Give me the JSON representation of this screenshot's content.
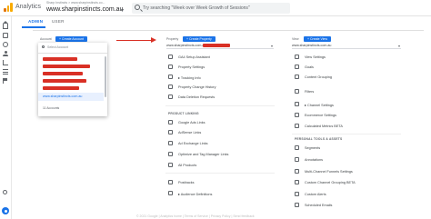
{
  "header": {
    "app_title": "Analytics",
    "account_small": "Sharp Instincts > www.sharpinstincts.co...",
    "account_name": "www.sharpinstincts.com.au",
    "search_placeholder": "Try searching \"Week over Week Growth of Sessions\""
  },
  "tabs": {
    "admin": "ADMIN",
    "user": "USER"
  },
  "account_column": {
    "label": "Account",
    "create_button": "+ Create Account",
    "dropdown": {
      "search_placeholder": "Select Account",
      "selected_item": "www.sharpinstincts.com.au",
      "footer": "11 Accounts"
    }
  },
  "property_column": {
    "label": "Property",
    "create_button": "+ Create Property",
    "selected": "www.sharpinstincts.com.au",
    "items": [
      {
        "icon": "ga4-icon",
        "label": "GA4 Setup Assistant"
      },
      {
        "icon": "settings-icon",
        "label": "Property Settings"
      },
      {
        "icon": "code-icon",
        "label": "Tracking Info",
        "expandable": true
      },
      {
        "icon": "history-icon",
        "label": "Property Change History"
      },
      {
        "icon": "dd-icon",
        "label": "Data Deletion Requests"
      }
    ],
    "section_product_links": "PRODUCT LINKING",
    "product_links": [
      {
        "icon": "ads-icon",
        "label": "Google Ads Links"
      },
      {
        "icon": "adsense-icon",
        "label": "AdSense Links"
      },
      {
        "icon": "exchange-icon",
        "label": "Ad Exchange Links"
      },
      {
        "icon": "optimize-icon",
        "label": "Optimize and Tag Manager Links"
      },
      {
        "icon": "products-icon",
        "label": "All Products"
      }
    ],
    "postbacks": "Postbacks",
    "audience": "Audience Definitions"
  },
  "view_column": {
    "label": "View",
    "create_button": "+ Create View",
    "selected": "www.sharpinstincts.com.au",
    "items": [
      {
        "icon": "view-settings-icon",
        "label": "View Settings"
      },
      {
        "icon": "goals-icon",
        "label": "Goals"
      },
      {
        "icon": "grouping-icon",
        "label": "Content Grouping"
      },
      {
        "icon": "filter-icon",
        "label": "Filters"
      },
      {
        "icon": "channel-icon",
        "label": "Channel Settings",
        "expandable": true
      },
      {
        "icon": "ecommerce-icon",
        "label": "Ecommerce Settings"
      },
      {
        "icon": "calc-icon",
        "label": "Calculated Metrics BETA"
      }
    ],
    "section_personal": "PERSONAL TOOLS & ASSETS",
    "personal_items": [
      {
        "icon": "segments-icon",
        "label": "Segments"
      },
      {
        "icon": "annotations-icon",
        "label": "Annotations"
      },
      {
        "icon": "funnel-icon",
        "label": "Multi-Channel Funnels Settings"
      },
      {
        "icon": "custom-channel-icon",
        "label": "Custom Channel Grouping BETA"
      },
      {
        "icon": "alerts-icon",
        "label": "Custom Alerts"
      },
      {
        "icon": "email-icon",
        "label": "Scheduled Emails"
      }
    ]
  },
  "footer": "© 2021 Google  |  Analytics home  |  Terms of Service  |  Privacy Policy  |  Send feedback",
  "colors": {
    "accent": "#1a73e8",
    "redaction": "#d93025",
    "logo": "#f9ab00"
  }
}
